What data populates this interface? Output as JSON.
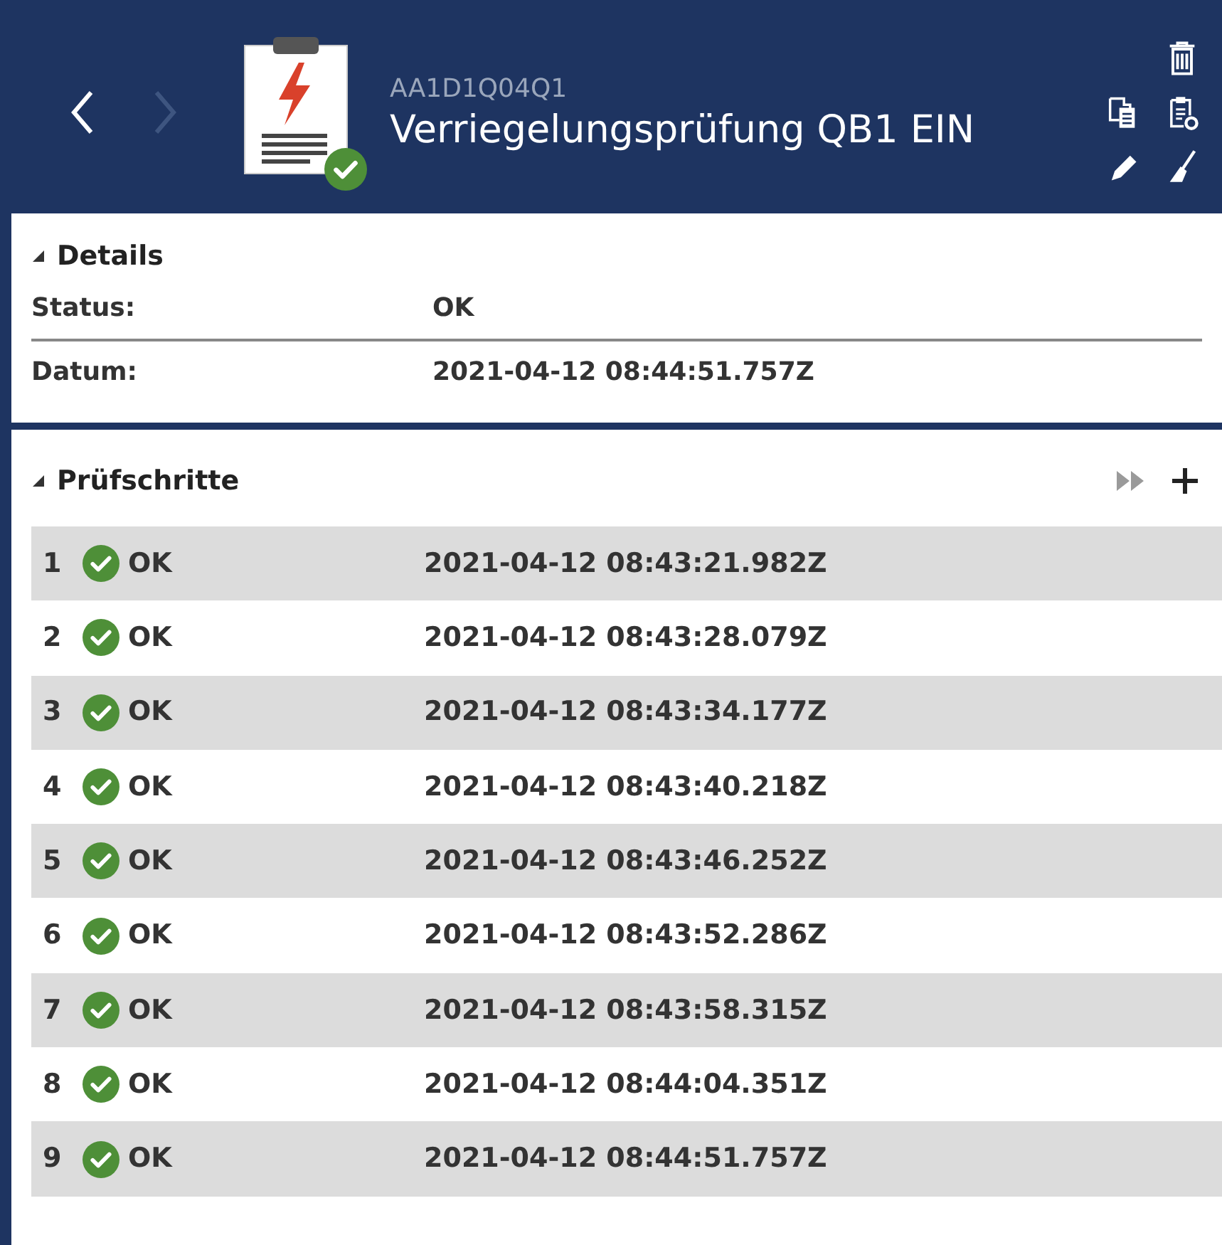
{
  "header": {
    "nav": [
      {
        "kind": "back",
        "disabled": false
      },
      {
        "kind": "forward",
        "disabled": true
      }
    ],
    "code": "AA1D1Q04Q1",
    "title": "Verriegelungsprüfung QB1 EIN"
  },
  "details": {
    "heading": "Details",
    "expanded": true,
    "fields": [
      {
        "label": "Status:",
        "value": "OK"
      },
      {
        "label": "Datum:",
        "value": "2021-04-12 08:44:51.757Z"
      }
    ]
  },
  "steps": {
    "heading": "Prüfschritte",
    "expanded": true,
    "rows": [
      {
        "number": "1",
        "status": "OK",
        "time": "2021-04-12 08:43:21.982Z"
      },
      {
        "number": "2",
        "status": "OK",
        "time": "2021-04-12 08:43:28.079Z"
      },
      {
        "number": "3",
        "status": "OK",
        "time": "2021-04-12 08:43:34.177Z"
      },
      {
        "number": "4",
        "status": "OK",
        "time": "2021-04-12 08:43:40.218Z"
      },
      {
        "number": "5",
        "status": "OK",
        "time": "2021-04-12 08:43:46.252Z"
      },
      {
        "number": "6",
        "status": "OK",
        "time": "2021-04-12 08:43:52.286Z"
      },
      {
        "number": "7",
        "status": "OK",
        "time": "2021-04-12 08:43:58.315Z"
      },
      {
        "number": "8",
        "status": "OK",
        "time": "2021-04-12 08:44:04.351Z"
      },
      {
        "number": "9",
        "status": "OK",
        "time": "2021-04-12 08:44:51.757Z"
      }
    ]
  }
}
